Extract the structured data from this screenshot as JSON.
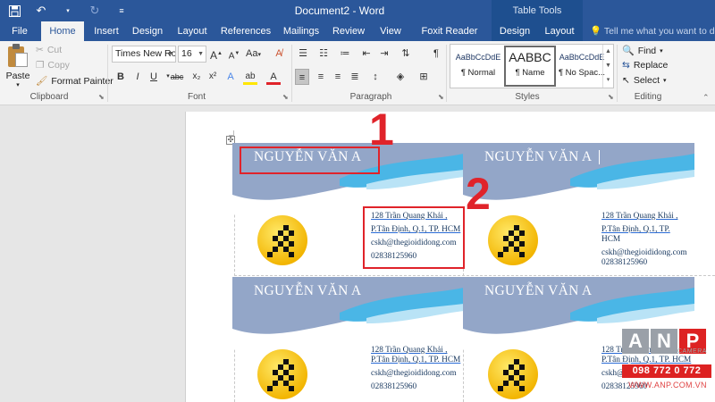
{
  "window": {
    "title": "Document2 - Word",
    "contextual_group": "Table Tools"
  },
  "tabs": [
    {
      "label": "File"
    },
    {
      "label": "Home"
    },
    {
      "label": "Insert"
    },
    {
      "label": "Design"
    },
    {
      "label": "Layout"
    },
    {
      "label": "References"
    },
    {
      "label": "Mailings"
    },
    {
      "label": "Review"
    },
    {
      "label": "View"
    },
    {
      "label": "Foxit Reader PDF"
    },
    {
      "label": "Design"
    },
    {
      "label": "Layout"
    }
  ],
  "tell_me": "Tell me what you want to do...",
  "ribbon": {
    "clipboard": {
      "label": "Clipboard",
      "paste": "Paste",
      "cut": "Cut",
      "copy": "Copy",
      "format_painter": "Format Painter"
    },
    "font": {
      "label": "Font",
      "family": "Times New Ro",
      "size": "16",
      "grow": "A",
      "shrink": "A",
      "change_case": "Aa",
      "bold": "B",
      "italic": "I",
      "underline": "U",
      "strike": "abc",
      "subscript": "x₂",
      "superscript": "x²",
      "text_effects": "A",
      "highlight": "ab",
      "font_color": "A"
    },
    "paragraph": {
      "label": "Paragraph"
    },
    "styles": {
      "label": "Styles",
      "items": [
        {
          "preview": "AaBbCcDdE",
          "name": "¶ Normal"
        },
        {
          "preview": "AABBC",
          "name": "¶ Name"
        },
        {
          "preview": "AaBbCcDdE",
          "name": "¶ No Spac..."
        }
      ]
    },
    "editing": {
      "label": "Editing",
      "find": "Find",
      "replace": "Replace",
      "select": "Select"
    }
  },
  "cards": [
    {
      "name": "NGUYỄN VĂN A",
      "address1": "128 Trần Quang Khải ,",
      "address2": "P.Tân Định, Q.1, TP. HCM",
      "email": "cskh@thegioididong.com",
      "phone": "02838125960"
    },
    {
      "name": "NGUYỄN VĂN A",
      "address1": "128 Trần Quang Khải ,",
      "address2": "P.Tân Định, Q.1, TP.",
      "address3": "HCM",
      "email": "cskh@thegioididong.com",
      "phone": "02838125960"
    },
    {
      "name": "NGUYỄN VĂN A",
      "address1": "128 Trần Quang Khải ,",
      "address2": "P.Tân Định, Q.1, TP. HCM",
      "email": "cskh@thegioididong.com",
      "phone": "02838125960"
    },
    {
      "name": "NGUYỄN VĂN A",
      "address1": "128 Trần Quang Khải ,",
      "address2": "P.Tân Định, Q.1, TP. HCM",
      "email": "cskh@thegioididong.com",
      "phone": "02838125960"
    }
  ],
  "annotations": {
    "one": "1",
    "two": "2"
  },
  "watermark": {
    "letters": [
      "A",
      "N",
      "P"
    ],
    "camera": "CAMERA",
    "phone": "098 772 0 772",
    "site": "WWW.ANP.COM.VN"
  },
  "colors": {
    "accent": "#2b579a",
    "contextual": "#1e4f8f",
    "annotation_red": "#e0232a",
    "card_text": "#17375e",
    "logo_yellow": "#f7c400"
  }
}
